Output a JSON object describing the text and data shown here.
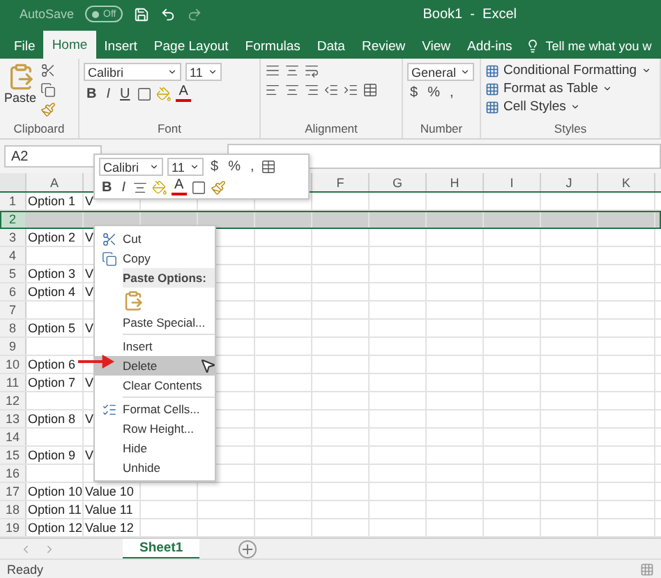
{
  "title_bar": {
    "autosave_label": "AutoSave",
    "autosave_state": "Off",
    "autosave_on": false,
    "title": "Book1  -  Excel"
  },
  "ribbon_tabs": [
    {
      "label": "File",
      "selected": false
    },
    {
      "label": "Home",
      "selected": true
    },
    {
      "label": "Insert",
      "selected": false
    },
    {
      "label": "Page Layout",
      "selected": false
    },
    {
      "label": "Formulas",
      "selected": false
    },
    {
      "label": "Data",
      "selected": false
    },
    {
      "label": "Review",
      "selected": false
    },
    {
      "label": "View",
      "selected": false
    },
    {
      "label": "Add-ins",
      "selected": false
    }
  ],
  "tell_me": "Tell me what you w",
  "ribbon": {
    "clipboard": {
      "paste": "Paste",
      "label": "Clipboard"
    },
    "font": {
      "name": "Calibri",
      "size": "11",
      "bold": "B",
      "italic": "I",
      "underline": "U",
      "font_color": "A",
      "label": "Font"
    },
    "alignment": {
      "label": "Alignment"
    },
    "number": {
      "format": "General",
      "currency": "$",
      "percent": "%",
      "comma": ",",
      "label": "Number"
    },
    "styles": {
      "items": [
        "Conditional Formatting",
        "Format as Table",
        "Cell Styles"
      ],
      "label": "Styles"
    }
  },
  "name_box": "A2",
  "mini_toolbar": {
    "font": "Calibri",
    "size": "11",
    "currency": "$",
    "percent": "%",
    "comma": ",",
    "bold": "B",
    "italic": "I",
    "font_color": "A"
  },
  "column_headers": {
    "left": [
      "A"
    ],
    "right": [
      "F",
      "G",
      "H",
      "I",
      "J",
      "K"
    ]
  },
  "rows": [
    {
      "number": "1",
      "option": "Option 1",
      "value": "V",
      "selected": false
    },
    {
      "number": "2",
      "selected": true
    },
    {
      "number": "3",
      "option": "Option 2",
      "value": "V",
      "selected": false
    },
    {
      "number": "4",
      "selected": false
    },
    {
      "number": "5",
      "option": "Option 3",
      "value": "V",
      "selected": false
    },
    {
      "number": "6",
      "option": "Option 4",
      "value": "V",
      "selected": false
    },
    {
      "number": "7",
      "selected": false
    },
    {
      "number": "8",
      "option": "Option 5",
      "value": "V",
      "selected": false
    },
    {
      "number": "9",
      "selected": false
    },
    {
      "number": "10",
      "option": "Option 6",
      "selected": false
    },
    {
      "number": "11",
      "option": "Option 7",
      "value": "V",
      "selected": false
    },
    {
      "number": "12",
      "selected": false
    },
    {
      "number": "13",
      "option": "Option 8",
      "value": "V",
      "selected": false
    },
    {
      "number": "14",
      "selected": false
    },
    {
      "number": "15",
      "option": "Option 9",
      "value": "V",
      "selected": false
    },
    {
      "number": "16",
      "selected": false
    },
    {
      "number": "17",
      "option": "Option 10",
      "value": "Value 10",
      "selected": false
    },
    {
      "number": "18",
      "option": "Option 11",
      "value": "Value 11",
      "selected": false
    },
    {
      "number": "19",
      "option": "Option 12",
      "value": "Value 12",
      "selected": false
    }
  ],
  "context_menu": [
    {
      "kind": "cut",
      "label": "Cut",
      "highlighted": false
    },
    {
      "kind": "copy",
      "label": "Copy",
      "highlighted": false
    },
    {
      "kind": "header",
      "label": "Paste Options:"
    },
    {
      "kind": "paste_icon"
    },
    {
      "kind": "item",
      "label": "Paste Special...",
      "highlighted": false
    },
    {
      "kind": "separator"
    },
    {
      "kind": "item",
      "label": "Insert",
      "highlighted": false
    },
    {
      "kind": "item",
      "label": "Delete",
      "highlighted": true
    },
    {
      "kind": "item",
      "label": "Clear Contents",
      "highlighted": false
    },
    {
      "kind": "separator"
    },
    {
      "kind": "format",
      "label": "Format Cells...",
      "highlighted": false
    },
    {
      "kind": "item",
      "label": "Row Height...",
      "highlighted": false
    },
    {
      "kind": "item",
      "label": "Hide",
      "highlighted": false
    },
    {
      "kind": "item",
      "label": "Unhide",
      "highlighted": false
    }
  ],
  "sheet_tabs": [
    {
      "label": "Sheet1",
      "selected": true
    }
  ],
  "status": "Ready"
}
